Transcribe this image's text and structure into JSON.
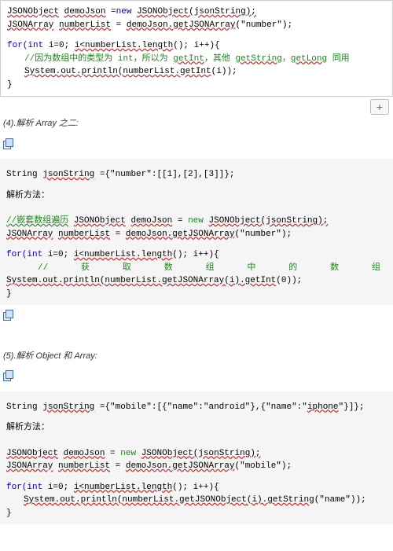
{
  "box1": {
    "l1a": "JSONObject",
    "l1b": "demoJson",
    "l1c": "=",
    "l1d": "new",
    "l1e": "JSONObject(jsonString);",
    "l2a": "JSONArray",
    "l2b": "numberList",
    "l2c": "=",
    "l2d": "demoJson.getJSONArray",
    "l2e": "(\"number\");",
    "l3a": "for(",
    "l3b": "int",
    "l3c": "i=0;",
    "l3d": "i<numberList.length",
    "l3e": "(); i++){",
    "l4": "//因为数组中的类型为 int，所以为",
    "l4b": "getInt",
    "l4c": "，其他",
    "l4d": "getString",
    "l4e": "，",
    "l4f": "getLong",
    "l4g": "同用",
    "l5a": "System.out.println",
    "l5b": "(numberList.getInt",
    "l5c": "(i));",
    "l6": "}",
    "plus": "+"
  },
  "sec4": {
    "title": "(4).解析 Array 之二:",
    "l1a": "String",
    "l1b": "jsonString",
    "l1c": "={\"number\":[[1],[2],[3]]};",
    "method": "解析方法：",
    "c1a": "//嵌套数组遍历",
    "c1b": "JSONObject",
    "c1c": "demoJson",
    "c1d": "=",
    "c1e": "new",
    "c1f": "JSONObject(jsonString);",
    "c2a": "JSONArray",
    "c2b": "numberList",
    "c2c": "=",
    "c2d": "demoJson.getJSONArray",
    "c2e": "(\"number\");",
    "c3a": "for(",
    "c3b": "int",
    "c3c": "i=0;",
    "c3d": "i<numberList.length",
    "c3e": "(); i++){",
    "cc": {
      "a": "//",
      "b": "获",
      "c": "取",
      "d": "数",
      "e": "组",
      "f": "中",
      "g": "的",
      "h": "数",
      "i": "组"
    },
    "c4a": "System.out.println",
    "c4b": "(numberList.getJSONArray",
    "c4c": "(i).getInt",
    "c4d": "(0));",
    "c5": "}"
  },
  "sec5": {
    "title": "(5).解析 Object 和 Array:",
    "l1a": "String",
    "l1b": "jsonString",
    "l1c": "={\"mobile\":[{\"name\":\"android\"},{\"name\":\"",
    "l1d": "iphone",
    "l1e": "\"}]};",
    "method": "解析方法：",
    "c1a": "JSONObject",
    "c1b": "demoJson",
    "c1c": "=",
    "c1d": "new",
    "c1e": "JSONObject(jsonString);",
    "c2a": "JSONArray",
    "c2b": "numberList",
    "c2c": "=",
    "c2d": "demoJson.getJSONArray",
    "c2e": "(\"mobile\");",
    "c3a": "for(",
    "c3b": "int",
    "c3c": "i=0;",
    "c3d": "i<numberList.length",
    "c3e": "(); i++){",
    "c4a": "System.out.println",
    "c4b": "(numberList.getJSONObject",
    "c4c": "(i).getString",
    "c4d": "(\"name\"));",
    "c5": "}"
  }
}
